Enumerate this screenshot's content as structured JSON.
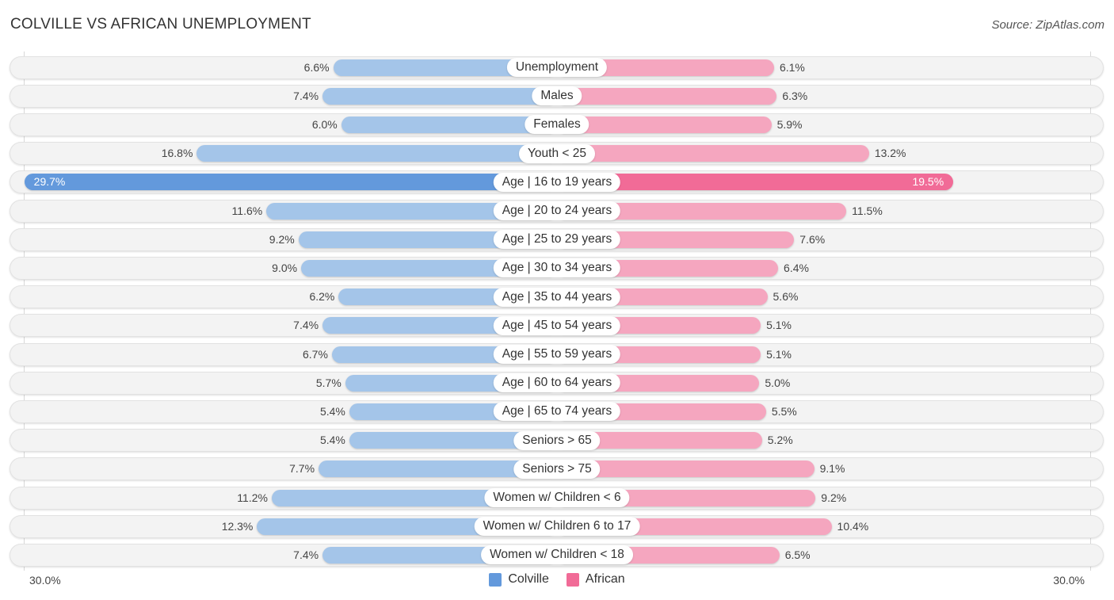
{
  "title": "COLVILLE VS AFRICAN UNEMPLOYMENT",
  "source": "Source: ZipAtlas.com",
  "colors": {
    "colville": "#a4c5e9",
    "colville_highlight": "#6399dc",
    "african": "#f5a6bf",
    "african_highlight": "#f16b97"
  },
  "chart_data": {
    "type": "bar",
    "orientation": "horizontal-diverging",
    "title": "COLVILLE VS AFRICAN UNEMPLOYMENT",
    "categories": [
      "Unemployment",
      "Males",
      "Females",
      "Youth < 25",
      "Age | 16 to 19 years",
      "Age | 20 to 24 years",
      "Age | 25 to 29 years",
      "Age | 30 to 34 years",
      "Age | 35 to 44 years",
      "Age | 45 to 54 years",
      "Age | 55 to 59 years",
      "Age | 60 to 64 years",
      "Age | 65 to 74 years",
      "Seniors > 65",
      "Seniors > 75",
      "Women w/ Children < 6",
      "Women w/ Children 6 to 17",
      "Women w/ Children < 18"
    ],
    "series": [
      {
        "name": "Colville",
        "side": "left",
        "values": [
          6.6,
          7.4,
          6.0,
          16.8,
          29.7,
          11.6,
          9.2,
          9.0,
          6.2,
          7.4,
          6.7,
          5.7,
          5.4,
          5.4,
          7.7,
          11.2,
          12.3,
          7.4
        ],
        "labels": [
          "6.6%",
          "7.4%",
          "6.0%",
          "16.8%",
          "29.7%",
          "11.6%",
          "9.2%",
          "9.0%",
          "6.2%",
          "7.4%",
          "6.7%",
          "5.7%",
          "5.4%",
          "5.4%",
          "7.7%",
          "11.2%",
          "12.3%",
          "7.4%"
        ]
      },
      {
        "name": "African",
        "side": "right",
        "values": [
          6.1,
          6.3,
          5.9,
          13.2,
          19.5,
          11.5,
          7.6,
          6.4,
          5.6,
          5.1,
          5.1,
          5.0,
          5.5,
          5.2,
          9.1,
          9.2,
          10.4,
          6.5
        ],
        "labels": [
          "6.1%",
          "6.3%",
          "5.9%",
          "13.2%",
          "19.5%",
          "11.5%",
          "7.6%",
          "6.4%",
          "5.6%",
          "5.1%",
          "5.1%",
          "5.0%",
          "5.5%",
          "5.2%",
          "9.1%",
          "9.2%",
          "10.4%",
          "6.5%"
        ]
      }
    ],
    "highlight_index": 4,
    "xlim": [
      0,
      30.0
    ],
    "axis_tick_labels": {
      "left": "30.0%",
      "right": "30.0%"
    },
    "legend": [
      "Colville",
      "African"
    ],
    "legend_position": "bottom-center",
    "grid": false
  }
}
